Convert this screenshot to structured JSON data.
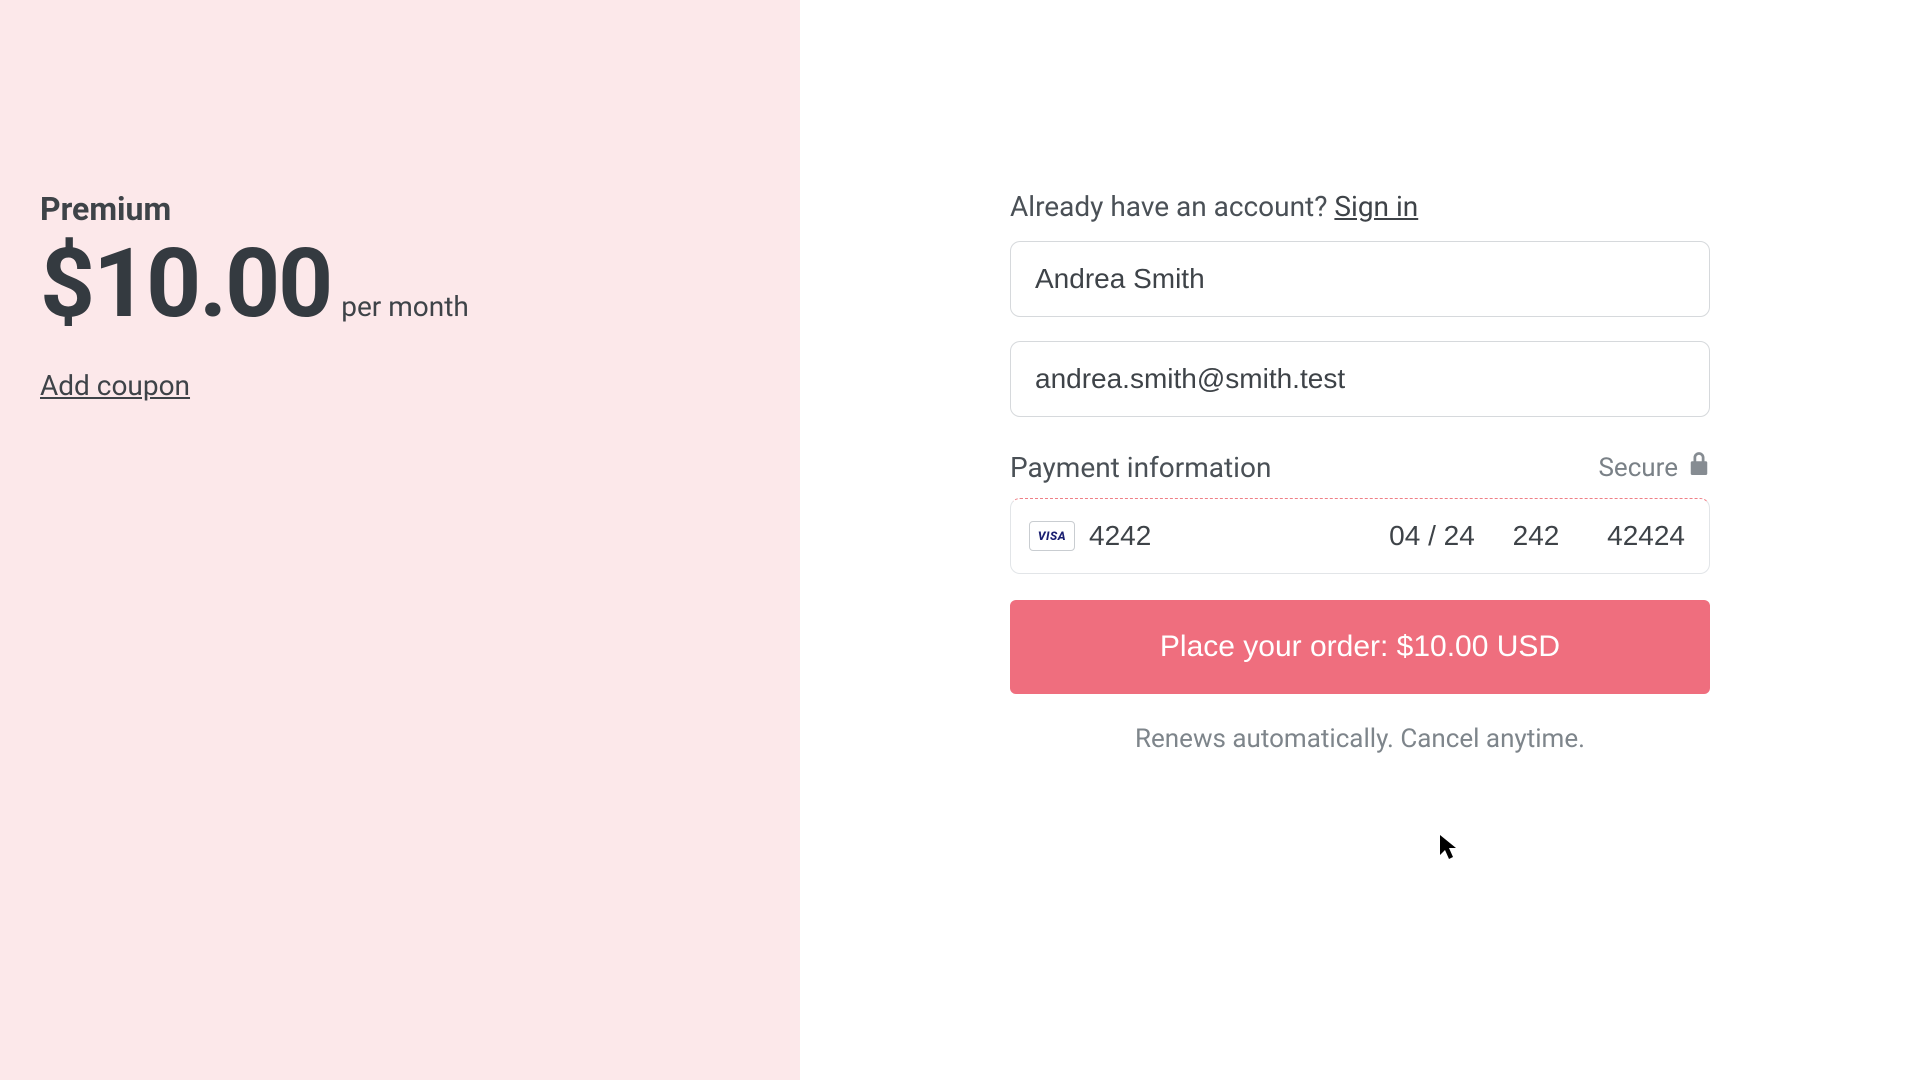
{
  "plan": {
    "name": "Premium",
    "price": "$10.00",
    "period": "per month",
    "coupon_link": "Add coupon"
  },
  "account": {
    "prompt": "Already have an account? ",
    "signin": "Sign in"
  },
  "form": {
    "name_value": "Andrea Smith",
    "email_value": "andrea.smith@smith.test"
  },
  "payment": {
    "title": "Payment information",
    "secure_label": "Secure",
    "brand": "VISA",
    "card_number": "4242",
    "expiry": "04 / 24",
    "cvc": "242",
    "zip": "42424"
  },
  "cta": {
    "label": "Place your order: $10.00 USD"
  },
  "footer": {
    "note": "Renews automatically. Cancel anytime."
  }
}
